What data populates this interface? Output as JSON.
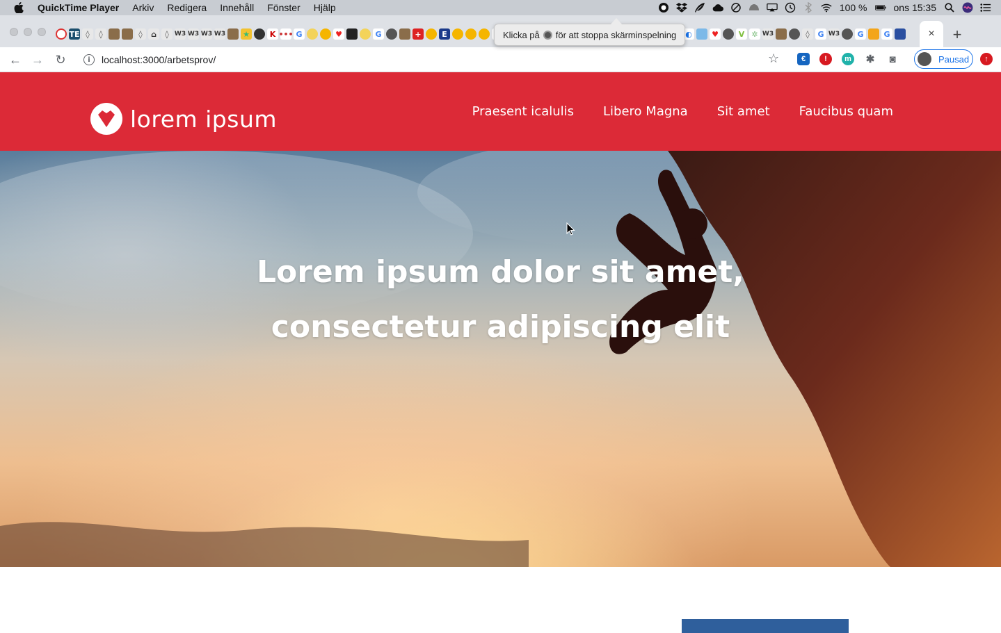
{
  "menubar": {
    "app_name": "QuickTime Player",
    "menus": [
      "Arkiv",
      "Redigera",
      "Innehåll",
      "Fönster",
      "Hjälp"
    ],
    "battery": "100 %",
    "clock": "ons 15:35"
  },
  "recording_tooltip": {
    "before": "Klicka på",
    "after": "för att stoppa skärminspelning"
  },
  "browser": {
    "url": "localhost:3000/arbetsprov/",
    "profile_label": "Pausad",
    "close_tab": "×",
    "new_tab": "+"
  },
  "site": {
    "logo_text": "lorem ipsum",
    "nav": [
      "Praesent icalulis",
      "Libero Magna",
      "Sit amet",
      "Faucibus quam"
    ],
    "hero_line1": "Lorem ipsum dolor sit amet,",
    "hero_line2": "consectetur adipiscing elit",
    "brand_color": "#dc2a37"
  }
}
